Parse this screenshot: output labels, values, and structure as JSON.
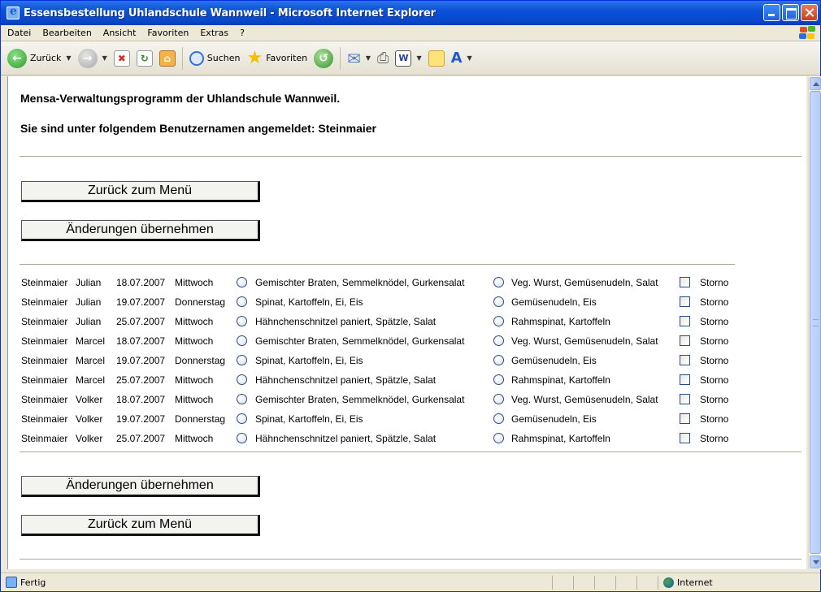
{
  "window": {
    "title": "Essensbestellung Uhlandschule Wannweil - Microsoft Internet Explorer"
  },
  "menubar": {
    "items": [
      "Datei",
      "Bearbeiten",
      "Ansicht",
      "Favoriten",
      "Extras",
      "?"
    ]
  },
  "toolbar": {
    "back_label": "Zurück",
    "search_label": "Suchen",
    "favorites_label": "Favoriten"
  },
  "page": {
    "heading1": "Mensa-Verwaltungsprogramm der Uhlandschule Wannweil.",
    "heading2": "Sie sind unter folgendem Benutzernamen angemeldet: Steinmaier",
    "btn_menu": "Zurück zum Menü",
    "btn_apply": "Änderungen übernehmen",
    "storno_label": "Storno",
    "orders": [
      {
        "last": "Steinmaier",
        "first": "Julian",
        "date": "18.07.2007",
        "day": "Mittwoch",
        "meal1": "Gemischter Braten, Semmelknödel, Gurkensalat",
        "meal2": "Veg. Wurst, Gemüsenudeln, Salat"
      },
      {
        "last": "Steinmaier",
        "first": "Julian",
        "date": "19.07.2007",
        "day": "Donnerstag",
        "meal1": "Spinat, Kartoffeln, Ei, Eis",
        "meal2": "Gemüsenudeln, Eis"
      },
      {
        "last": "Steinmaier",
        "first": "Julian",
        "date": "25.07.2007",
        "day": "Mittwoch",
        "meal1": "Hähnchenschnitzel paniert, Spätzle, Salat",
        "meal2": "Rahmspinat, Kartoffeln"
      },
      {
        "last": "Steinmaier",
        "first": "Marcel",
        "date": "18.07.2007",
        "day": "Mittwoch",
        "meal1": "Gemischter Braten, Semmelknödel, Gurkensalat",
        "meal2": "Veg. Wurst, Gemüsenudeln, Salat"
      },
      {
        "last": "Steinmaier",
        "first": "Marcel",
        "date": "19.07.2007",
        "day": "Donnerstag",
        "meal1": "Spinat, Kartoffeln, Ei, Eis",
        "meal2": "Gemüsenudeln, Eis"
      },
      {
        "last": "Steinmaier",
        "first": "Marcel",
        "date": "25.07.2007",
        "day": "Mittwoch",
        "meal1": "Hähnchenschnitzel paniert, Spätzle, Salat",
        "meal2": "Rahmspinat, Kartoffeln"
      },
      {
        "last": "Steinmaier",
        "first": "Volker",
        "date": "18.07.2007",
        "day": "Mittwoch",
        "meal1": "Gemischter Braten, Semmelknödel, Gurkensalat",
        "meal2": "Veg. Wurst, Gemüsenudeln, Salat"
      },
      {
        "last": "Steinmaier",
        "first": "Volker",
        "date": "19.07.2007",
        "day": "Donnerstag",
        "meal1": "Spinat, Kartoffeln, Ei, Eis",
        "meal2": "Gemüsenudeln, Eis"
      },
      {
        "last": "Steinmaier",
        "first": "Volker",
        "date": "25.07.2007",
        "day": "Mittwoch",
        "meal1": "Hähnchenschnitzel paniert, Spätzle, Salat",
        "meal2": "Rahmspinat, Kartoffeln"
      }
    ]
  },
  "statusbar": {
    "status": "Fertig",
    "zone": "Internet"
  },
  "colors": {
    "titlebar": "#0a52d8",
    "content_bg": "#ffffff",
    "chrome": "#ece9d8",
    "rule": "#aca899"
  }
}
